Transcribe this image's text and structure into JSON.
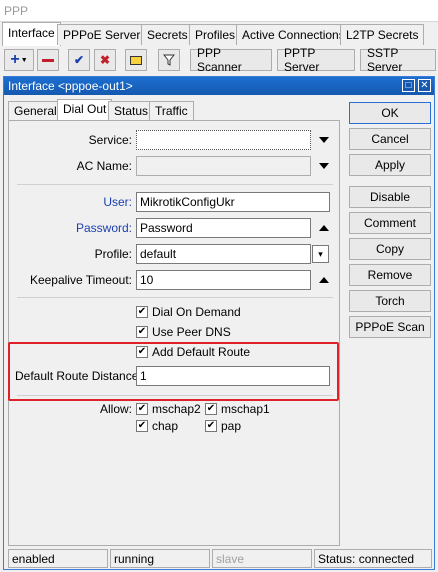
{
  "app": {
    "title": "PPP"
  },
  "main_tabs": [
    "Interface",
    "PPPoE Servers",
    "Secrets",
    "Profiles",
    "Active Connections",
    "L2TP Secrets"
  ],
  "toolbar": {
    "ppp_scanner": "PPP Scanner",
    "pptp_server": "PPTP Server",
    "sstp_server": "SSTP Server"
  },
  "window": {
    "title": "Interface <pppoe-out1>"
  },
  "inner_tabs": [
    "General",
    "Dial Out",
    "Status",
    "Traffic"
  ],
  "form": {
    "service_label": "Service:",
    "service_value": "",
    "ac_name_label": "AC Name:",
    "ac_name_value": "",
    "user_label": "User:",
    "user_value": "MikrotikConfigUkr",
    "password_label": "Password:",
    "password_value": "Password",
    "profile_label": "Profile:",
    "profile_value": "default",
    "keepalive_label": "Keepalive Timeout:",
    "keepalive_value": "10",
    "dial_on_demand": "Dial On Demand",
    "use_peer_dns": "Use Peer DNS",
    "add_default_route": "Add Default Route",
    "default_route_distance_label": "Default Route Distance:",
    "default_route_distance_value": "1",
    "allow_label": "Allow:",
    "allow": [
      "mschap2",
      "mschap1",
      "chap",
      "pap"
    ]
  },
  "buttons": [
    "OK",
    "Cancel",
    "Apply",
    "Disable",
    "Comment",
    "Copy",
    "Remove",
    "Torch",
    "PPPoE Scan"
  ],
  "statusbar": {
    "state": "enabled",
    "run": "running",
    "slave": "slave",
    "status": "Status: connected"
  },
  "colors": {
    "accent": "#1559b0",
    "highlight_box": "#e0202a",
    "label_blue": "#1a3fb0"
  }
}
